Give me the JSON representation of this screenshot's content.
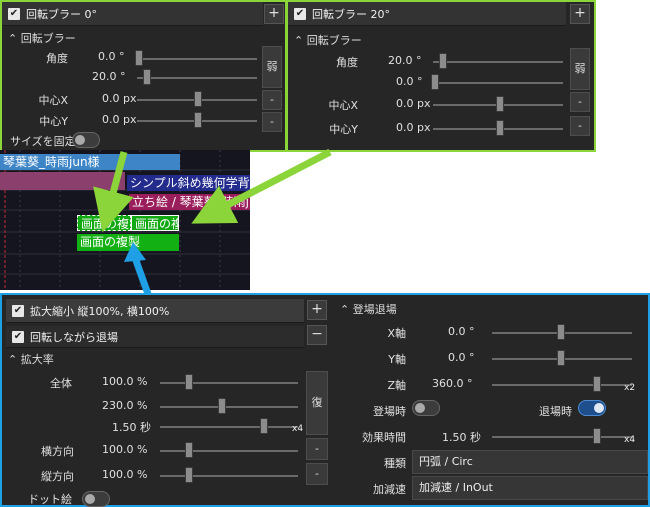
{
  "panel_a": {
    "title": "回転ブラー 0°",
    "plus": "+",
    "section": "回転ブラー",
    "angle_label": "角度",
    "angle_value_1": "0.0 °",
    "angle_value_2": "20.0 °",
    "weak_btn": "弱",
    "center_x_label": "中心X",
    "center_x_value": "0.0 px",
    "center_y_label": "中心Y",
    "center_y_value": "0.0 px",
    "minus": "-",
    "fix_size_label": "サイズを固定"
  },
  "panel_b": {
    "title": "回転ブラー 20°",
    "plus": "+",
    "section": "回転ブラー",
    "angle_label": "角度",
    "angle_value_1": "20.0 °",
    "angle_value_2": "0.0 °",
    "weak_btn": "弱",
    "center_x_label": "中心X",
    "center_x_value": "0.0 px",
    "center_y_label": "中心Y",
    "center_y_value": "0.0 px",
    "minus": "-"
  },
  "timeline": {
    "clips": [
      "琴葉葵_時雨jun様",
      "シンプル斜め幾何学背景",
      "立ち絵 / 琴葉葵_時雨jun",
      "画面の複",
      "画面の複",
      "画面の複製"
    ]
  },
  "panel_c": {
    "left": {
      "checkbox1_label": "拡大縮小 縦100%, 横100%",
      "checkbox2_label": "回転しながら退場",
      "plus": "+",
      "minus": "−",
      "section": "拡大率",
      "all_label": "全体",
      "all_value": "100.0 %",
      "value2": "230.0 %",
      "value3": "1.50 秒",
      "x4": "x4",
      "restore_btn": "復",
      "horiz_label": "横方向",
      "horiz_value": "100.0 %",
      "vert_label": "縦方向",
      "vert_value": "100.0 %",
      "small_minus": "-",
      "dot_label": "ドット絵"
    },
    "right": {
      "section": "登場退場",
      "x_label": "X軸",
      "x_value": "0.0 °",
      "y_label": "Y軸",
      "y_value": "0.0 °",
      "z_label": "Z軸",
      "z_value": "360.0 °",
      "x2": "x2",
      "enter_label": "登場時",
      "exit_label": "退場時",
      "duration_label": "効果時間",
      "duration_value": "1.50 秒",
      "x4": "x4",
      "type_label": "種類",
      "type_value": "円弧 / Circ",
      "easing_label": "加減速",
      "easing_value": "加減速 / InOut"
    }
  },
  "progress": {
    "angle_a": 0.0,
    "angle_b": 0.2,
    "center": 0.5,
    "all": 0.15,
    "value2": 0.3,
    "value3": 0.85,
    "horiz": 0.15,
    "vert": 0.15,
    "x_axis": 0.5,
    "y_axis": 0.5,
    "z_axis": 0.85,
    "duration": 0.85,
    "enter_toggle": 0,
    "exit_toggle": 1
  },
  "colors": {
    "green_highlight": "#8bd43a",
    "blue_highlight": "#1f9fe6",
    "toggle_on": "#1f4e8c"
  }
}
